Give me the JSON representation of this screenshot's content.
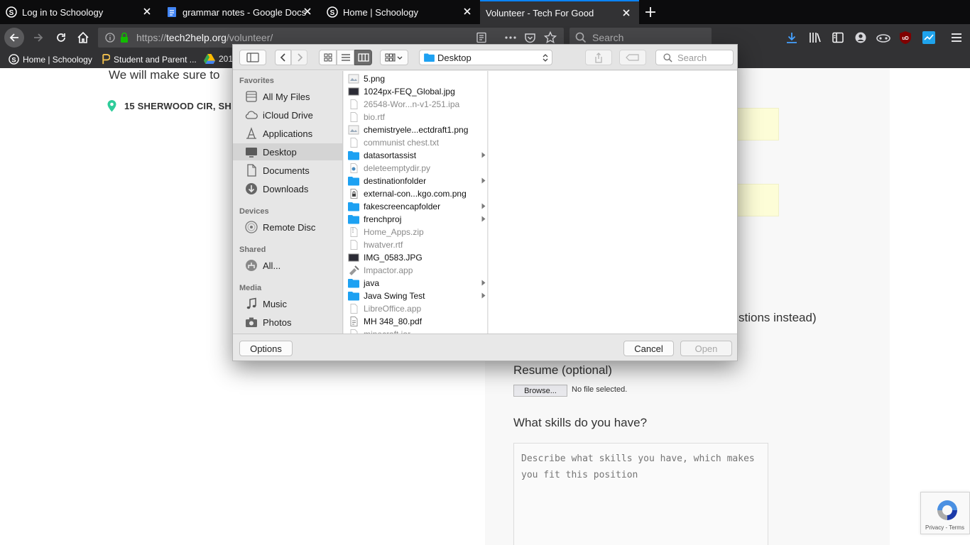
{
  "tabs": [
    {
      "title": "Log in to Schoology",
      "icon": "schoology-icon"
    },
    {
      "title": "grammar notes - Google Docs",
      "icon": "google-docs-icon"
    },
    {
      "title": "Home | Schoology",
      "icon": "schoology-icon"
    },
    {
      "title": "Volunteer - Tech For Good",
      "icon": "none",
      "active": true
    }
  ],
  "urlbar": {
    "prefix": "https://",
    "host": "tech2help.org",
    "path": "/volunteer/"
  },
  "searchbar": {
    "placeholder": "Search"
  },
  "bookmarks": [
    {
      "label": "Home | Schoology",
      "icon": "schoology-icon"
    },
    {
      "label": "Student and Parent ...",
      "icon": "parent-portal-icon"
    },
    {
      "label": "201",
      "icon": "google-drive-icon"
    }
  ],
  "page": {
    "lead_text": "We will make sure to",
    "address": "15 SHERWOOD CIR, SH",
    "tail_text": "stions instead)",
    "resume_label": "Resume (optional)",
    "browse_label": "Browse...",
    "no_file_text": "No file selected.",
    "skills_label": "What skills do you have?",
    "skills_placeholder": "Describe what skills you have, which makes you fit this position",
    "recaptcha_terms": "Privacy - Terms"
  },
  "dialog": {
    "location": "Desktop",
    "search_placeholder": "Search",
    "sidebar": {
      "favorites_heading": "Favorites",
      "favorites": [
        {
          "label": "All My Files",
          "icon": "all-files-icon"
        },
        {
          "label": "iCloud Drive",
          "icon": "cloud-icon"
        },
        {
          "label": "Applications",
          "icon": "applications-icon"
        },
        {
          "label": "Desktop",
          "icon": "desktop-icon",
          "selected": true
        },
        {
          "label": "Documents",
          "icon": "documents-icon"
        },
        {
          "label": "Downloads",
          "icon": "downloads-icon"
        }
      ],
      "devices_heading": "Devices",
      "devices": [
        {
          "label": "Remote Disc",
          "icon": "disc-icon"
        }
      ],
      "shared_heading": "Shared",
      "shared": [
        {
          "label": "All...",
          "icon": "network-icon"
        }
      ],
      "media_heading": "Media",
      "media": [
        {
          "label": "Music",
          "icon": "music-icon"
        },
        {
          "label": "Photos",
          "icon": "camera-icon"
        }
      ]
    },
    "files": [
      {
        "name": "5.png",
        "kind": "image",
        "enabled": true,
        "folder": false
      },
      {
        "name": "1024px-FEQ_Global.jpg",
        "kind": "image-dark",
        "enabled": true,
        "folder": false
      },
      {
        "name": "26548-Wor...n-v1-251.ipa",
        "kind": "doc",
        "enabled": false,
        "folder": false
      },
      {
        "name": "bio.rtf",
        "kind": "doc",
        "enabled": false,
        "folder": false
      },
      {
        "name": "chemistryele...ectdraft1.png",
        "kind": "image",
        "enabled": true,
        "folder": false
      },
      {
        "name": "communist chest.txt",
        "kind": "doc",
        "enabled": false,
        "folder": false
      },
      {
        "name": "datasortassist",
        "kind": "folder",
        "enabled": true,
        "folder": true
      },
      {
        "name": "deleteemptydir.py",
        "kind": "python",
        "enabled": false,
        "folder": false
      },
      {
        "name": "destinationfolder",
        "kind": "folder",
        "enabled": true,
        "folder": true
      },
      {
        "name": "external-con...kgo.com.png",
        "kind": "lock",
        "enabled": true,
        "folder": false
      },
      {
        "name": "fakescreencapfolder",
        "kind": "folder",
        "enabled": true,
        "folder": true
      },
      {
        "name": "frenchproj",
        "kind": "folder",
        "enabled": true,
        "folder": true
      },
      {
        "name": "Home_Apps.zip",
        "kind": "zip",
        "enabled": false,
        "folder": false
      },
      {
        "name": "hwatver.rtf",
        "kind": "doc",
        "enabled": false,
        "folder": false
      },
      {
        "name": "IMG_0583.JPG",
        "kind": "image-dark",
        "enabled": true,
        "folder": false
      },
      {
        "name": "Impactor.app",
        "kind": "app",
        "enabled": false,
        "folder": false
      },
      {
        "name": "java",
        "kind": "folder",
        "enabled": true,
        "folder": true
      },
      {
        "name": "Java Swing Test",
        "kind": "folder",
        "enabled": true,
        "folder": true
      },
      {
        "name": "LibreOffice.app",
        "kind": "doc",
        "enabled": false,
        "folder": false
      },
      {
        "name": "MH 348_80.pdf",
        "kind": "pdf",
        "enabled": true,
        "folder": false
      },
      {
        "name": "minecraft.jar",
        "kind": "doc",
        "enabled": false,
        "folder": false
      }
    ],
    "options_label": "Options",
    "cancel_label": "Cancel",
    "open_label": "Open"
  },
  "colors": {
    "chrome_dark": "#0c0c0d",
    "toolbar": "#323234",
    "accent_blue": "#0a84ff",
    "folder_blue": "#1da1f2",
    "form_yellow": "#fdfdd7",
    "map_pin_green": "#2ecc9a"
  }
}
